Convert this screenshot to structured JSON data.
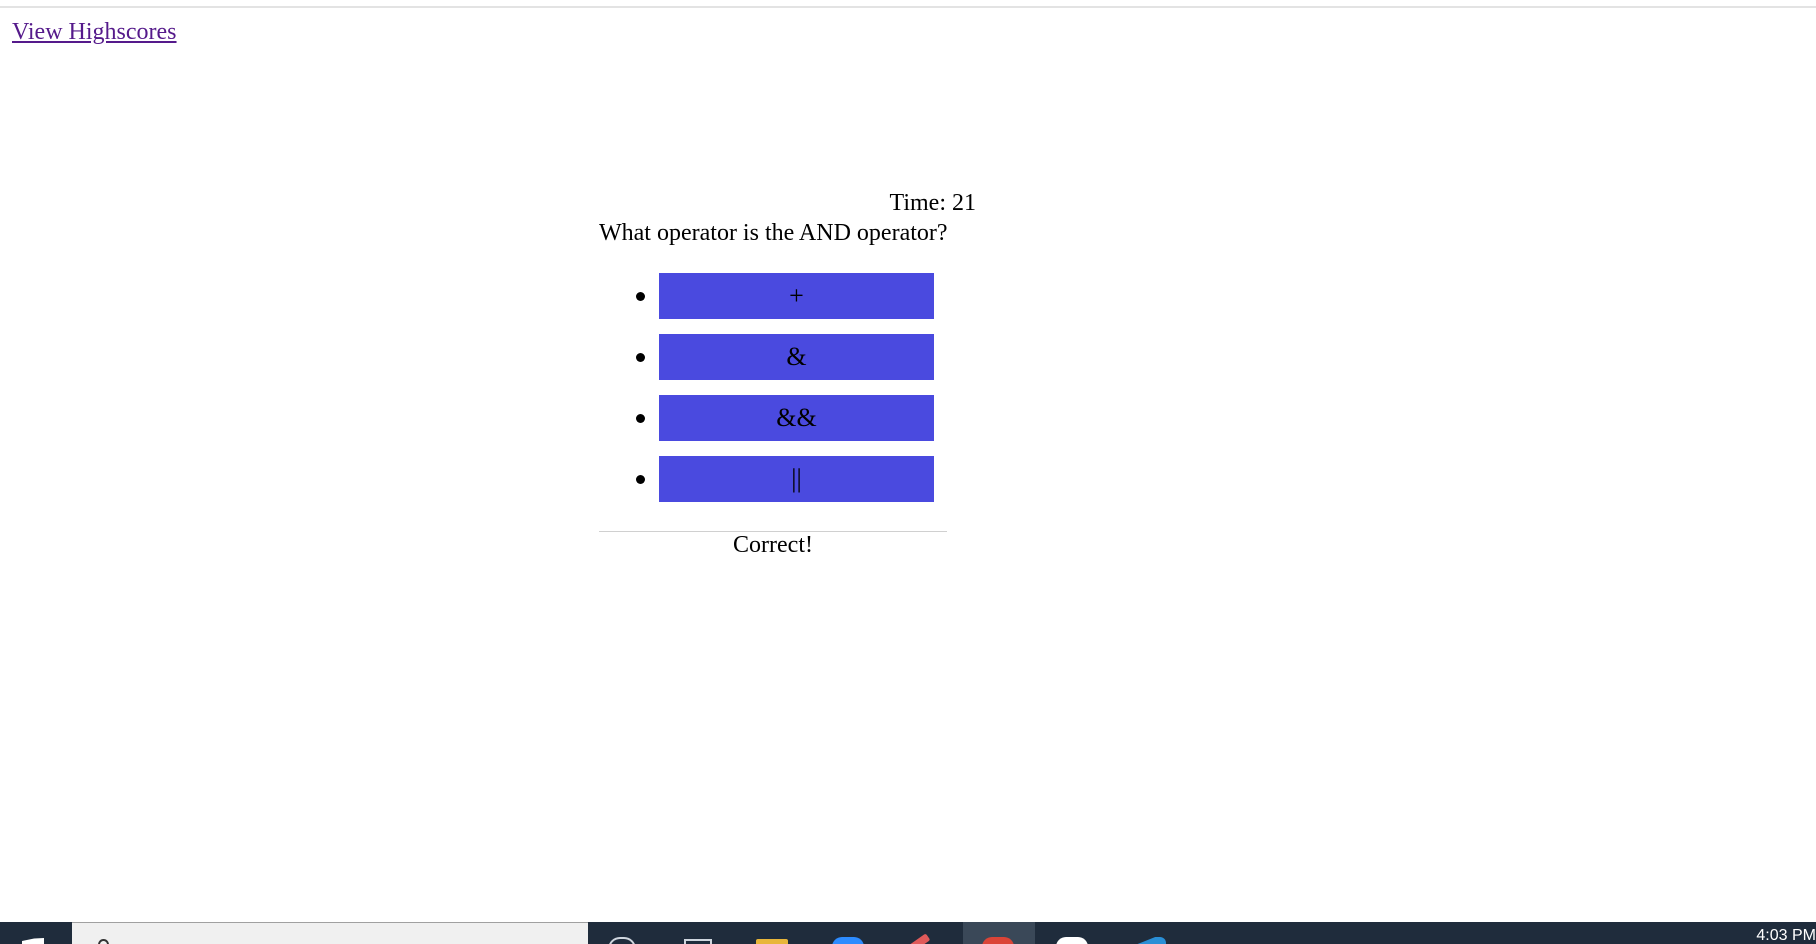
{
  "nav": {
    "highscores_label": "View Highscores"
  },
  "quiz": {
    "timer_label": "Time: 21",
    "question": "What operator is the AND operator?",
    "choices": [
      {
        "label": "+"
      },
      {
        "label": "&"
      },
      {
        "label": "&&"
      },
      {
        "label": "||"
      }
    ],
    "feedback": "Correct!",
    "button_color": "#4a4adf"
  },
  "taskbar": {
    "clock": "4:03 PM",
    "background_color": "#1f2c3c",
    "icons": [
      "windows-start-icon",
      "search-icon",
      "cortana-icon",
      "task-view-icon",
      "file-explorer-icon",
      "zoom-icon",
      "pen-app-icon",
      "chrome-icon",
      "slack-icon",
      "vscode-icon"
    ]
  }
}
